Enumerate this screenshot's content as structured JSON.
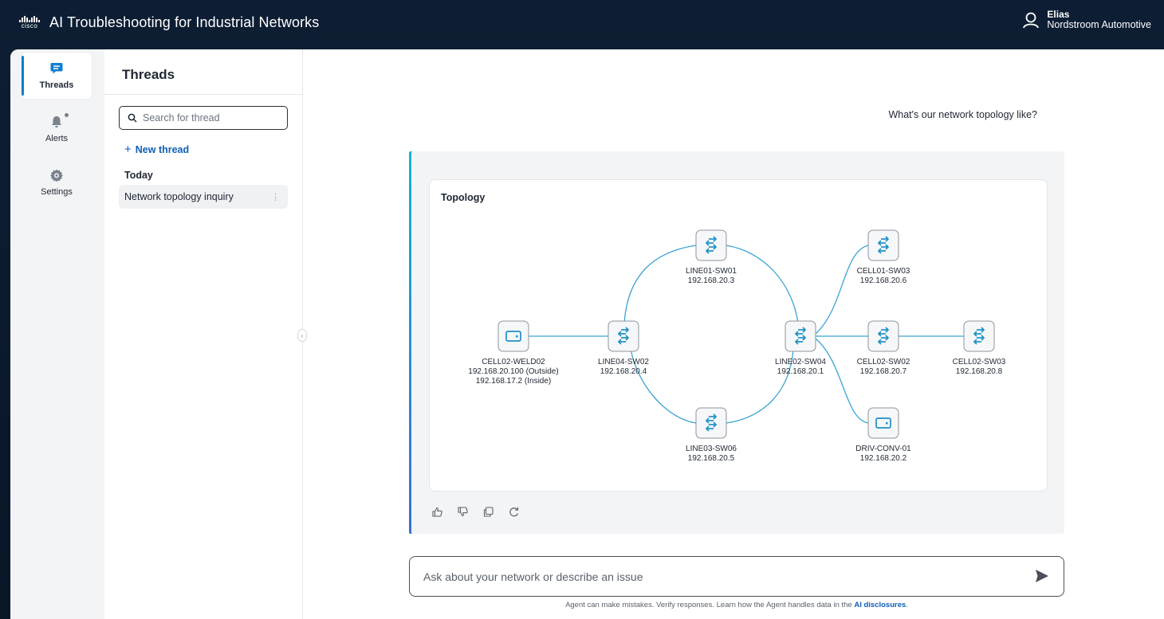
{
  "header": {
    "logo_text": "cisco",
    "app_title": "AI Troubleshooting for Industrial Networks",
    "user_name": "Elias",
    "user_org": "Nordstroom Automotive"
  },
  "nav": {
    "items": [
      {
        "label": "Threads",
        "icon": "chat-icon",
        "active": true
      },
      {
        "label": "Alerts",
        "icon": "bell-icon"
      },
      {
        "label": "Settings",
        "icon": "gear-icon"
      }
    ]
  },
  "threads": {
    "title": "Threads",
    "search_placeholder": "Search for thread",
    "new_thread_label": "New thread",
    "group_label": "Today",
    "items": [
      {
        "label": "Network topology inquiry"
      }
    ]
  },
  "conversation": {
    "user_message": "What's our network topology like?",
    "card_title": "Topology",
    "nodes": [
      {
        "name": "CELL02-WELD02",
        "ip": "192.168.20.100 (Outside)",
        "ip2": "192.168.17.2 (Inside)",
        "type": "device"
      },
      {
        "name": "LINE04-SW02",
        "ip": "192.168.20.4",
        "type": "switch"
      },
      {
        "name": "LINE01-SW01",
        "ip": "192.168.20.3",
        "type": "switch"
      },
      {
        "name": "LINE03-SW06",
        "ip": "192.168.20.5",
        "type": "switch"
      },
      {
        "name": "LINE02-SW04",
        "ip": "192.168.20.1",
        "type": "switch"
      },
      {
        "name": "CELL01-SW03",
        "ip": "192.168.20.6",
        "type": "switch"
      },
      {
        "name": "CELL02-SW02",
        "ip": "192.168.20.7",
        "type": "switch"
      },
      {
        "name": "CELL02-SW03",
        "ip": "192.168.20.8",
        "type": "switch"
      },
      {
        "name": "DRIV-CONV-01",
        "ip": "192.168.20.2",
        "type": "device"
      }
    ],
    "actions": [
      "thumbs-up-icon",
      "thumbs-down-icon",
      "copy-icon",
      "refresh-icon"
    ]
  },
  "composer": {
    "placeholder": "Ask about your network or describe an issue",
    "disclaimer": "Agent can make mistakes. Verify responses. Learn how the Agent handles data in the",
    "disclaimer_link": "AI disclosures",
    "disclaimer_end": "."
  },
  "colors": {
    "accent": "#0d7fd0",
    "link": "#0d5fb8",
    "node_icon": "#1e90c8",
    "edge": "#3ba3d4",
    "background": "#0b1a2e"
  }
}
